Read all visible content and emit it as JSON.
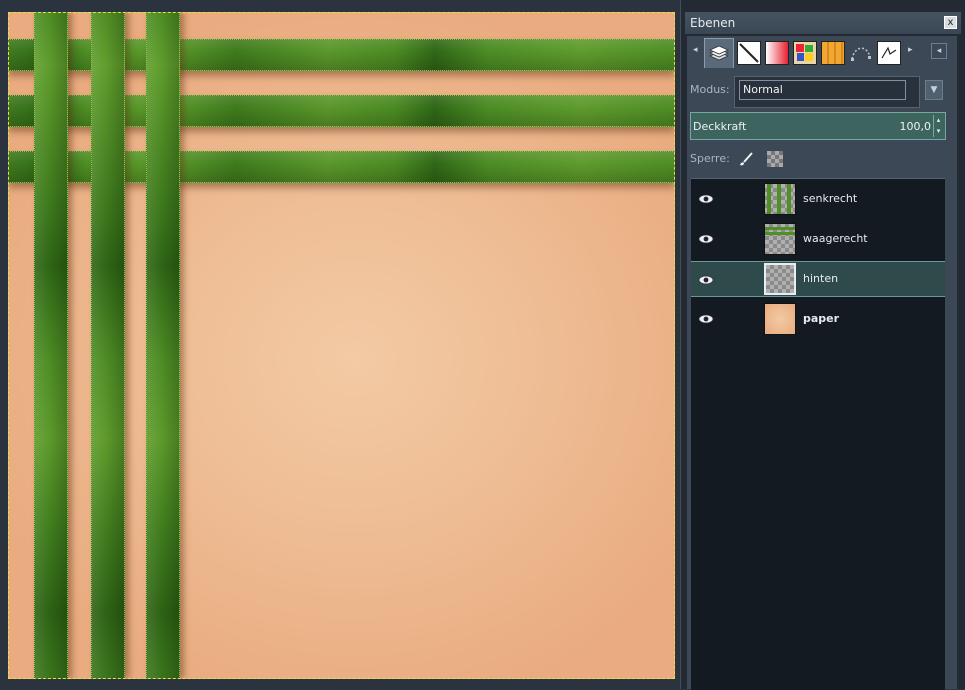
{
  "dock": {
    "title": "Ebenen",
    "close_label": "x",
    "tabs": [
      "layers-icon",
      "channels-icon",
      "gradients-icon",
      "palettes-icon",
      "patterns-icon",
      "paths-icon",
      "tool-presets-icon"
    ]
  },
  "layers_panel": {
    "mode_label": "Modus:",
    "mode_value": "Normal",
    "opacity_label": "Deckkraft",
    "opacity_value": "100,0",
    "lock_label": "Sperre:",
    "layers": [
      {
        "name": "senkrecht",
        "visible": true,
        "selected": false,
        "bold": false
      },
      {
        "name": "waagerecht",
        "visible": true,
        "selected": false,
        "bold": false
      },
      {
        "name": "hinten",
        "visible": true,
        "selected": true,
        "bold": false
      },
      {
        "name": "paper",
        "visible": true,
        "selected": false,
        "bold": true
      }
    ]
  },
  "colors": {
    "paper": "#efbf97",
    "ribbon_green": "#4f8f24",
    "selection_marquee": "#e8e04a",
    "panel_bg": "#3c4856",
    "list_bg": "#141a22",
    "opacity_bar": "#3e6460"
  }
}
